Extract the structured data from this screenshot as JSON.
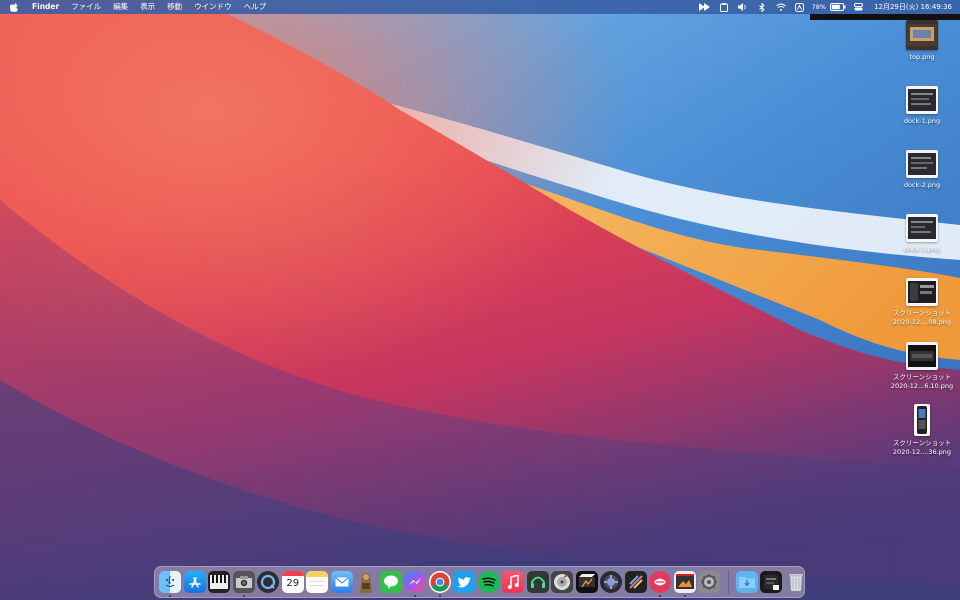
{
  "menubar": {
    "app_name": "Finder",
    "menus": [
      "ファイル",
      "編集",
      "表示",
      "移動",
      "ウインドウ",
      "ヘルプ"
    ],
    "battery_percent": "78%",
    "clock": "12月29日(火) 16:49:36"
  },
  "desktop_icons": [
    {
      "label": "top.png"
    },
    {
      "label": "dock-1.png"
    },
    {
      "label": "dock-2.png"
    },
    {
      "label": "dock-3.png"
    },
    {
      "label": "スクリーンショット",
      "label2": "2020-12....08.png"
    },
    {
      "label": "スクリーンショット",
      "label2": "2020-12...6.10.png"
    },
    {
      "label": "スクリーンショット",
      "label2": "2020-12....36.png"
    }
  ],
  "dock": {
    "calendar_day": "29",
    "apps": [
      {
        "name": "finder-icon",
        "color": "#5aa8f0"
      },
      {
        "name": "app-store-icon",
        "color": "#1e8cf0"
      },
      {
        "name": "piano-icon",
        "color": "#222222"
      },
      {
        "name": "photo-booth-icon",
        "color": "#6b6b6b"
      },
      {
        "name": "quicktime-icon",
        "color": "#3a6fb0"
      },
      {
        "name": "calendar-icon",
        "color": "#ffffff"
      },
      {
        "name": "notes-icon",
        "color": "#f5d66a"
      },
      {
        "name": "mail-icon",
        "color": "#4a9bf0"
      },
      {
        "name": "archive-utility-icon",
        "color": "#8b6b3a"
      },
      {
        "name": "line-icon",
        "color": "#2fc146"
      },
      {
        "name": "messenger-icon",
        "color": "#6a5cf5"
      },
      {
        "name": "chrome-icon",
        "color": "#ffffff"
      },
      {
        "name": "twitter-icon",
        "color": "#1da1f2"
      },
      {
        "name": "spotify-icon",
        "color": "#1db954"
      },
      {
        "name": "music-icon",
        "color": "#f2455a"
      },
      {
        "name": "headphones-icon",
        "color": "#303a38"
      },
      {
        "name": "disk-utility-icon",
        "color": "#e8e8e8"
      },
      {
        "name": "final-cut-icon",
        "color": "#222222"
      },
      {
        "name": "compressor-icon",
        "color": "#2a2a3a"
      },
      {
        "name": "motion-icon",
        "color": "#3a3a5a"
      },
      {
        "name": "speechify-icon",
        "color": "#e23a5a"
      },
      {
        "name": "photo-slideshow-icon",
        "color": "#3a3a3a"
      },
      {
        "name": "system-preferences-icon",
        "color": "#8a8a8a"
      }
    ],
    "right_items": [
      {
        "name": "downloads-folder-icon",
        "color": "#5fb3f0"
      },
      {
        "name": "screenshots-stack-icon",
        "color": "#222222"
      },
      {
        "name": "trash-icon",
        "color": "#cfd3d8"
      }
    ]
  },
  "colors": {
    "menubar_bg": "#375fa5",
    "wallpaper_red": "#e8394b",
    "wallpaper_blue": "#3b78c6",
    "wallpaper_orange": "#f2a04a"
  }
}
